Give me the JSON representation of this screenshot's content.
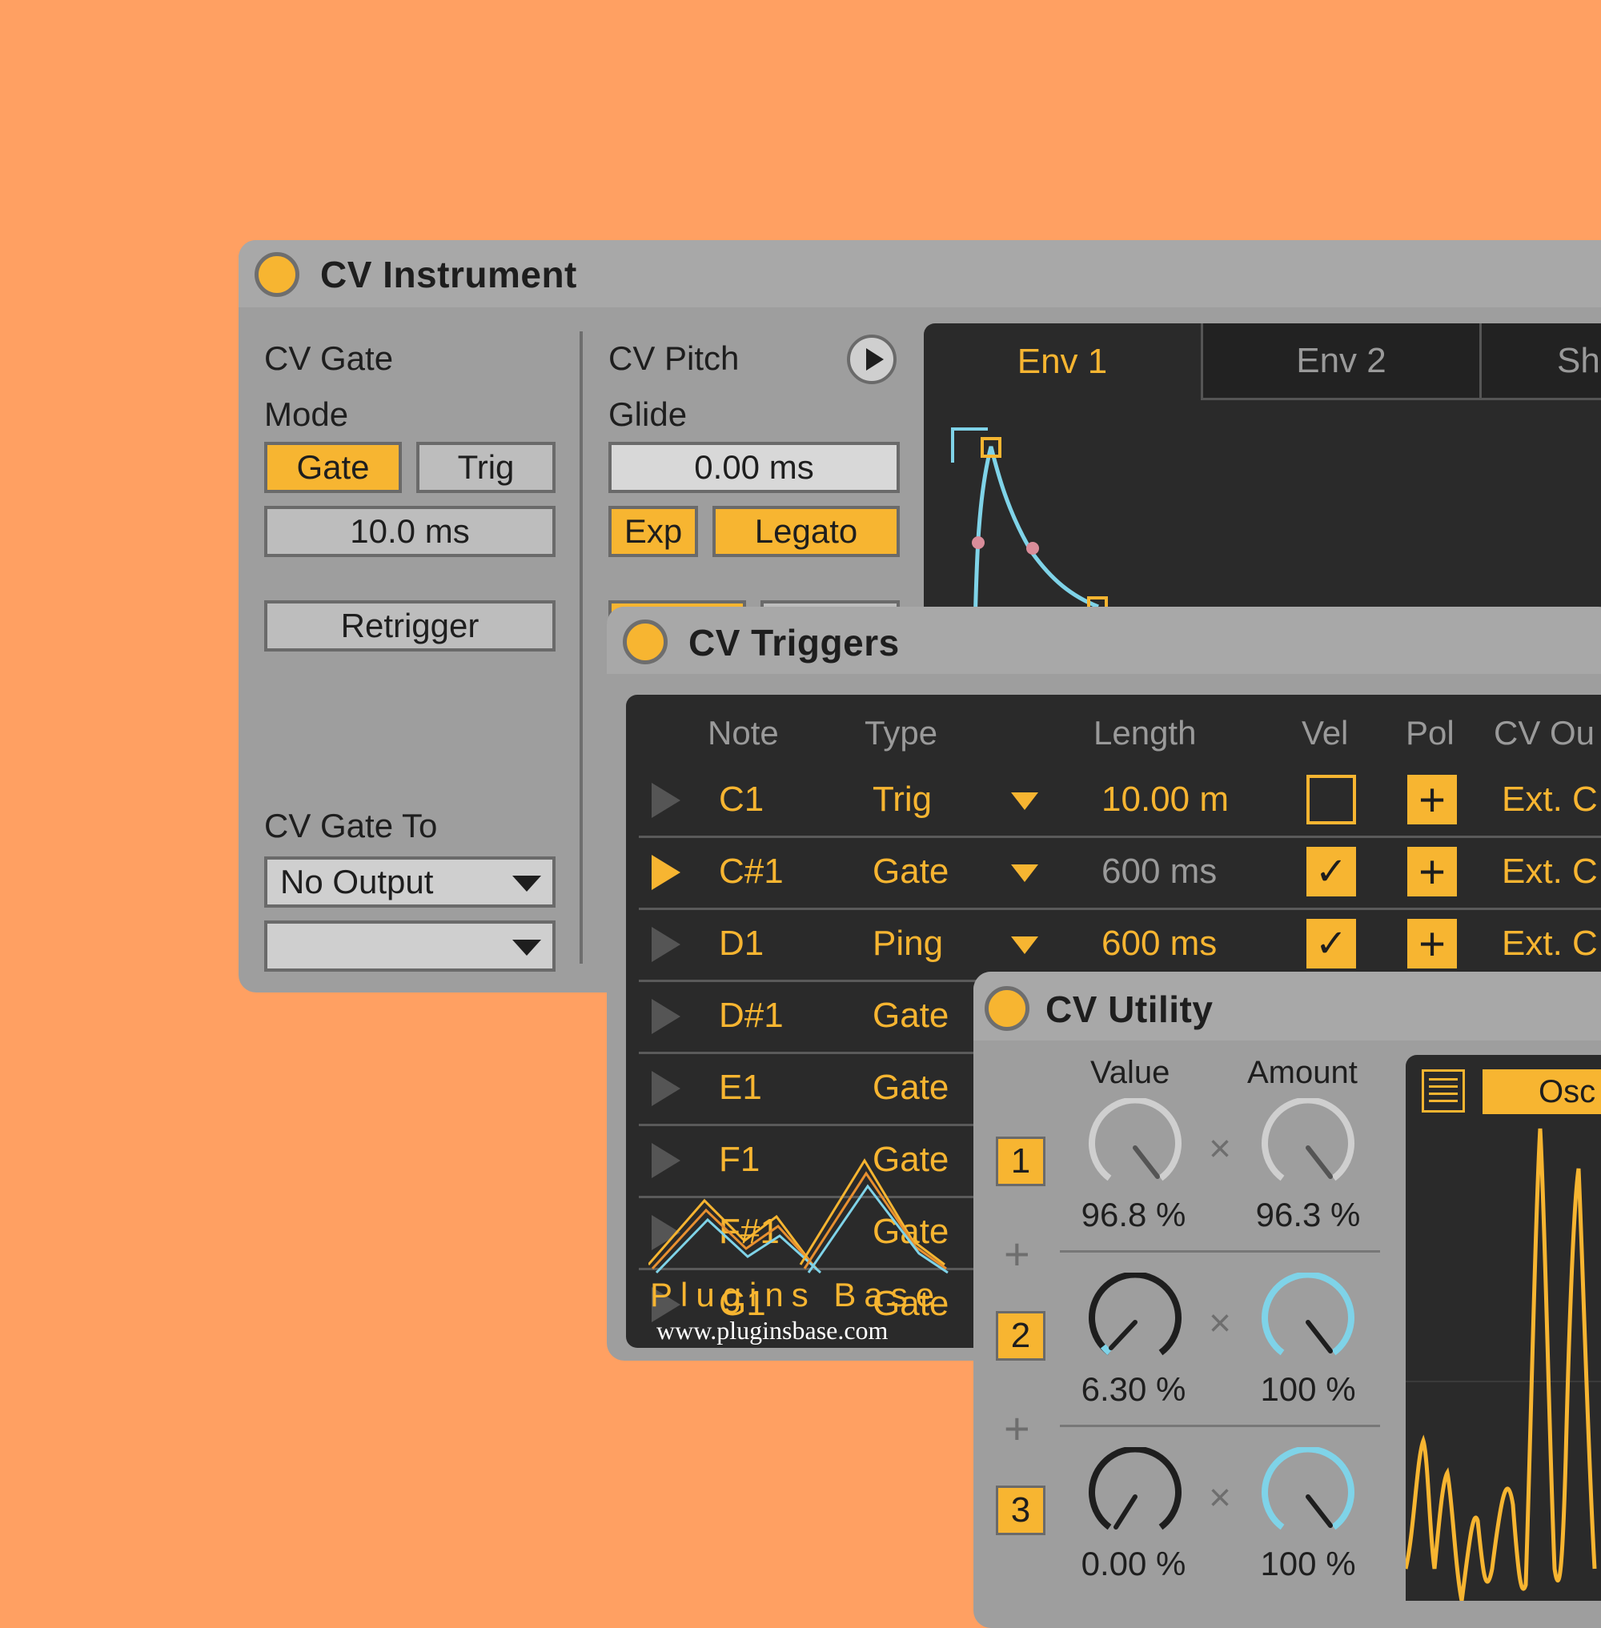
{
  "cv_instrument": {
    "title": "CV Instrument",
    "cv_gate_label": "CV Gate",
    "mode_label": "Mode",
    "mode_gate": "Gate",
    "mode_trig": "Trig",
    "gate_time": "10.0 ms",
    "retrigger": "Retrigger",
    "cv_gate_to_label": "CV Gate To",
    "gate_to_value": "No Output",
    "gate_to_channel": "",
    "cv_pitch_label": "CV Pitch",
    "glide_label": "Glide",
    "glide_value": "0.00 ms",
    "exp": "Exp",
    "legato": "Legato",
    "tabs": [
      "Env 1",
      "Env 2",
      "Sh"
    ]
  },
  "cv_triggers": {
    "title": "CV Triggers",
    "headers": [
      "Note",
      "Type",
      "Length",
      "Vel",
      "Pol",
      "CV Ou"
    ],
    "rows": [
      {
        "note": "C1",
        "type": "Trig",
        "length": "10.00 m",
        "vel": false,
        "pol": "+",
        "out": "Ext. C",
        "active": false
      },
      {
        "note": "C#1",
        "type": "Gate",
        "length": "600 ms",
        "vel": true,
        "pol": "+",
        "out": "Ext. C",
        "active": true
      },
      {
        "note": "D1",
        "type": "Ping",
        "length": "600 ms",
        "vel": true,
        "pol": "+",
        "out": "Ext. C",
        "active": false
      },
      {
        "note": "D#1",
        "type": "Gate"
      },
      {
        "note": "E1",
        "type": "Gate"
      },
      {
        "note": "F1",
        "type": "Gate"
      },
      {
        "note": "F#1",
        "type": "Gate"
      },
      {
        "note": "G1",
        "type": "Gate"
      }
    ]
  },
  "cv_utility": {
    "title": "CV Utility",
    "value_label": "Value",
    "amount_label": "Amount",
    "osc_tab": "Osc",
    "rows": [
      {
        "num": "1",
        "value": "96.8 %",
        "amount": "96.3 %"
      },
      {
        "num": "2",
        "value": "6.30 %",
        "amount": "100 %"
      },
      {
        "num": "3",
        "value": "0.00 %",
        "amount": "100 %"
      }
    ],
    "times_symbol": "×",
    "plus_symbol": "+"
  },
  "watermark": {
    "brand": "Plugins Base",
    "url": "www.pluginsbase.com"
  },
  "colors": {
    "background": "#FFA062",
    "accent": "#F7B531",
    "envelope": "#7FD3E8",
    "panel": "#9E9E9E",
    "dark": "#2A2A2A"
  }
}
